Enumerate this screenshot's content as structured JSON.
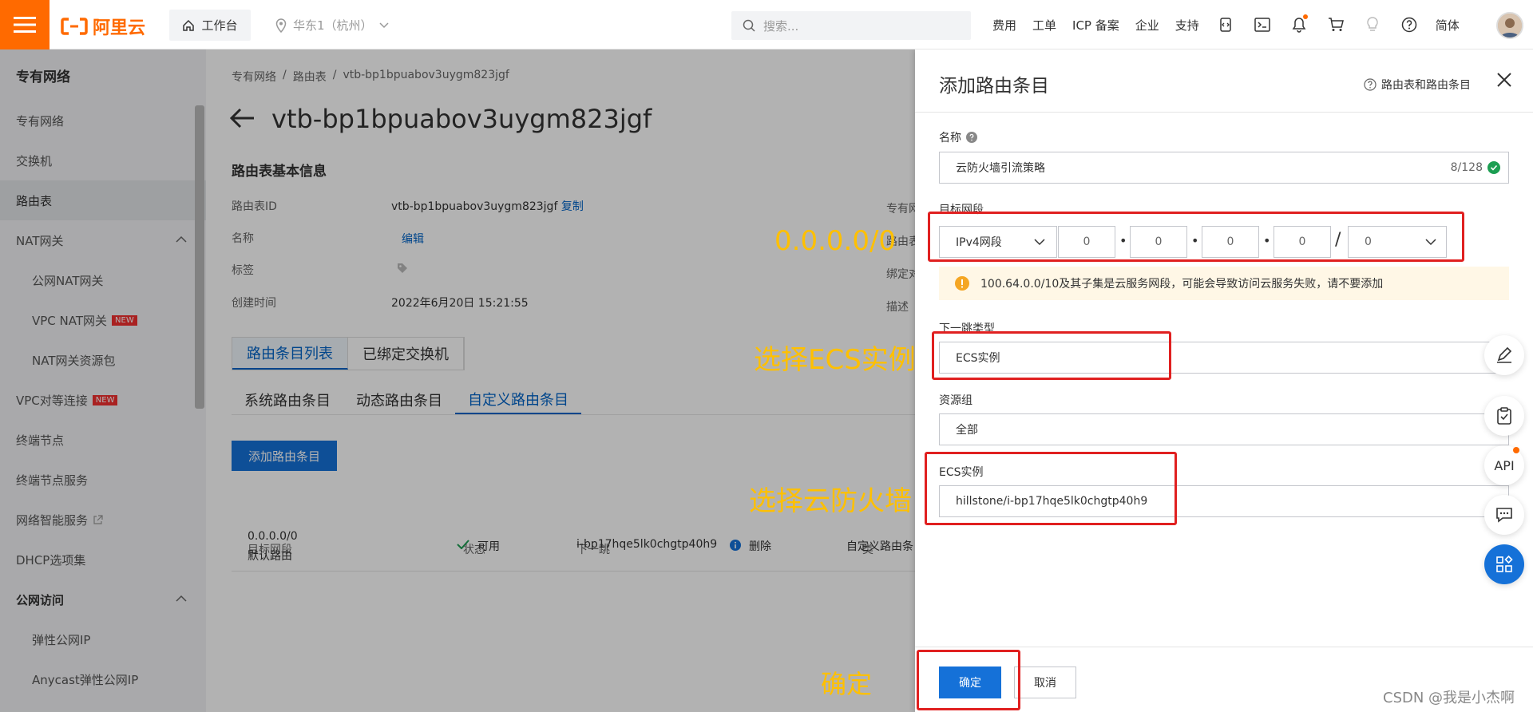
{
  "topbar": {
    "logo_text": "阿里云",
    "workbench": "工作台",
    "region": "华东1（杭州）",
    "search_placeholder": "搜索...",
    "nav": [
      "费用",
      "工单",
      "ICP 备案",
      "企业",
      "支持"
    ],
    "lang": "简体",
    "accent": "#ff6a00"
  },
  "sidebar": {
    "title": "专有网络",
    "items": [
      {
        "label": "专有网络"
      },
      {
        "label": "交换机"
      },
      {
        "label": "路由表"
      },
      {
        "label": "NAT网关"
      },
      {
        "label": "公网NAT网关"
      },
      {
        "label": "VPC NAT网关",
        "badge": "NEW"
      },
      {
        "label": "NAT网关资源包"
      },
      {
        "label": "VPC对等连接",
        "badge": "NEW"
      },
      {
        "label": "终端节点"
      },
      {
        "label": "终端节点服务"
      },
      {
        "label": "网络智能服务"
      },
      {
        "label": "DHCP选项集"
      },
      {
        "label": "公网访问"
      },
      {
        "label": "弹性公网IP"
      },
      {
        "label": "Anycast弹性公网IP"
      }
    ]
  },
  "main": {
    "breadcrumb": [
      "专有网络",
      "路由表",
      "vtb-bp1bpuabov3uygm823jgf"
    ],
    "breadcrumb_sep": "/",
    "title": "vtb-bp1bpuabov3uygm823jgf",
    "basic_info_heading": "路由表基本信息",
    "info": {
      "id_label": "路由表ID",
      "id_value": "vtb-bp1bpuabov3uygm823jgf",
      "copy": "复制",
      "name_label": "名称",
      "edit": "编辑",
      "tag_label": "标签",
      "created_label": "创建时间",
      "created_value": "2022年6月20日 15:21:55"
    },
    "right_labels": [
      "专有网",
      "路由表",
      "绑定对",
      "描述"
    ],
    "tabs_top": [
      "路由条目列表",
      "已绑定交换机"
    ],
    "tabs_sub": [
      "系统路由条目",
      "动态路由条目",
      "自定义路由条目"
    ],
    "add_route_button": "添加路由条目",
    "table": {
      "headers": [
        "目标网段",
        "状态",
        "下一跳",
        "类"
      ],
      "rows": [
        {
          "cidr": "0.0.0.0/0",
          "type_name": "默认路由",
          "status": "可用",
          "next_hop": "i-bp17hqe5lk0chgtp40h9",
          "delete": "删除",
          "route_type": "自定义路由条"
        }
      ]
    }
  },
  "annotations": {
    "cidr_note": "0.0.0.0/0",
    "select_ecs": "选择ECS实例",
    "select_firewall": "选择云防火墙",
    "confirm": "确定",
    "color": "#ffc000"
  },
  "drawer": {
    "title": "添加路由条目",
    "help_link": "路由表和路由条目",
    "name_label": "名称",
    "name_value": "云防火墙引流策略",
    "name_count": "8/128",
    "dest_label": "目标网段",
    "ip_type": "IPv4网段",
    "ip_octets": [
      "0",
      "0",
      "0",
      "0"
    ],
    "mask": "0",
    "slash": "/",
    "warning": "100.64.0.0/10及其子集是云服务网段，可能会导致访问云服务失败，请不要添加",
    "next_hop_label": "下一跳类型",
    "next_hop_value": "ECS实例",
    "rg_label": "资源组",
    "rg_value": "全部",
    "ecs_label": "ECS实例",
    "ecs_value": "hillstone/i-bp17hqe5lk0chgtp40h9",
    "ok": "确定",
    "cancel": "取消"
  },
  "floating": {
    "api": "API"
  },
  "watermark": "CSDN @我是小杰啊"
}
